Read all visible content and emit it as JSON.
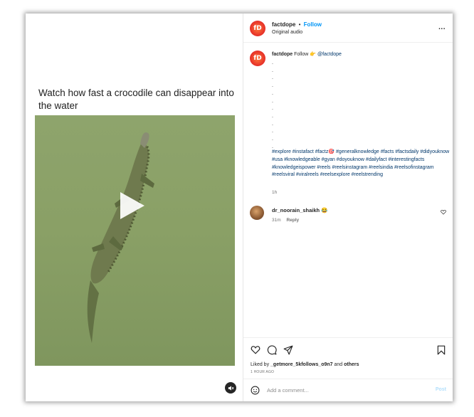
{
  "left": {
    "caption": "Watch how fast a crocodile can disappear into the water"
  },
  "header": {
    "username": "factdope",
    "separator": "•",
    "follow": "Follow",
    "audio": "Original audio",
    "more": "..."
  },
  "post": {
    "username": "factdope",
    "follow": "Follow",
    "emoji": "👉",
    "mention": "@factdope",
    "dots": [
      ".",
      ".",
      ".",
      ".",
      ".",
      ".",
      ".",
      ".",
      ".",
      ".",
      ".",
      "."
    ],
    "hashtags": "#explore #instafact #factz🎯 #generalknowledge #facts #factsdaily #didyouknow #usa #knowledgeable #gyan #doyouknow #dailyfact #interestingfacts #knowledgeispower #reels #reelsinstagram #reelsindia #reelsofinstagram #reelsviral #viralreels #reelsexplore #reelstrending",
    "time": "1h"
  },
  "comment": {
    "username": "dr_noorain_shaikh",
    "emoji": "😂",
    "time": "31m",
    "reply": "Reply"
  },
  "likes": {
    "prefix": "Liked by ",
    "user": "_getmore_5kfollows_o9n7",
    "and": " and ",
    "others": "others",
    "ago": "1 HOUR AGO"
  },
  "comment_box": {
    "placeholder": "Add a comment...",
    "post": "Post"
  },
  "colors": {
    "follow_blue": "#0095f6",
    "hashtag_blue": "#00376b",
    "video_green": "#8aa066",
    "avatar_red": "#e52d27"
  }
}
